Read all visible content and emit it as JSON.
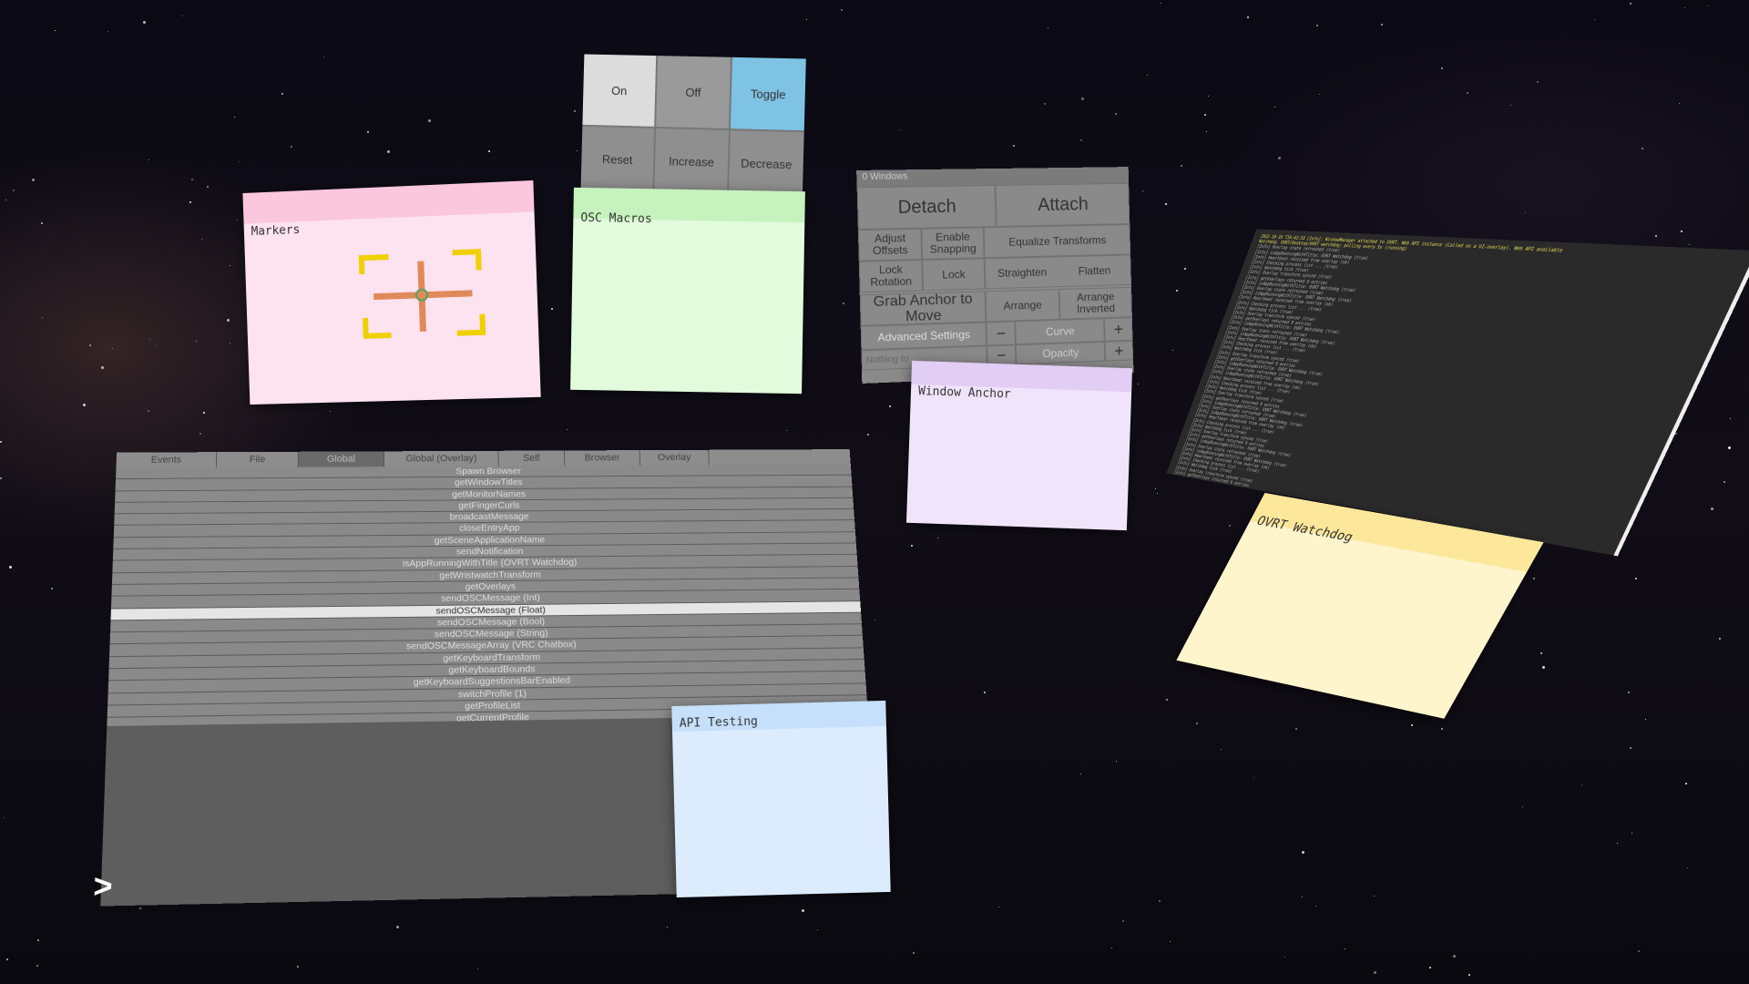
{
  "macro_buttons": {
    "on": "On",
    "off": "Off",
    "toggle": "Toggle",
    "reset": "Reset",
    "increase": "Increase",
    "decrease": "Decrease"
  },
  "notes": {
    "markers": "Markers",
    "osc_macros": "OSC Macros",
    "window_anchor": "Window Anchor",
    "api_testing": "API Testing",
    "ovrt_watchdog": "OVRT Watchdog"
  },
  "window_controls": {
    "title": "0 Windows",
    "detach": "Detach",
    "attach": "Attach",
    "adjust_offsets": "Adjust Offsets",
    "enable_snapping": "Enable Snapping",
    "equalize_transforms": "Equalize Transforms",
    "lock_rotation": "Lock Rotation",
    "lock": "Lock",
    "straighten": "Straighten",
    "flatten": "Flatten",
    "arrange": "Arrange",
    "arrange_inverted": "Arrange Inverted",
    "grab_anchor": "Grab Anchor to Move",
    "curve_minus": "−",
    "curve": "Curve",
    "curve_plus": "+",
    "opacity_minus": "−",
    "opacity": "Opacity",
    "opacity_plus": "+",
    "advanced_settings": "Advanced Settings",
    "status": "Nothing to"
  },
  "api_tabs": [
    "Events",
    "File",
    "Global",
    "Global (Overlay)",
    "Self",
    "Browser",
    "Overlay"
  ],
  "api_functions": [
    "Spawn Browser",
    "getWindowTitles",
    "getMonitorNames",
    "getFingerCurls",
    "broadcastMessage",
    "closeEntryApp",
    "getSceneApplicationName",
    "sendNotification",
    "isAppRunningWithTitle (OVRT Watchdog)",
    "getWristwatchTransform",
    "getOverlays",
    "sendOSCMessage (Int)",
    "sendOSCMessage (Float)",
    "sendOSCMessage (Bool)",
    "sendOSCMessage (String)",
    "sendOSCMessageArray (VRC Chatbox)",
    "getKeyboardTransform",
    "getKeyboardBounds",
    "getKeyboardSuggestionsBarEnabled",
    "switchProfile (1)",
    "getProfileList",
    "getCurrentProfile"
  ],
  "expand_glyph": ">",
  "log": {
    "line1": "2022-10-16 T16:42:33 [Info]: WindowManager attached to OVRT. Web API instance (Called on a UI-overlay). Web API available",
    "line2": "Watchdog: OVRT/Desktop/OVRT watchdog; polling every 5s (running)",
    "rows": [
      "[Info] Overlay state refreshed (true)",
      "[Info] isAppRunningWithTitle: OVRT Watchdog (true)",
      "[Info] Heartbeat received from overlay (ok)",
      "[Info] Checking process list ... (true)",
      "[Info] Watchdog tick (true)",
      "[Info] Overlay transform synced (true)",
      "[Info] getOverlays returned 9 entries",
      "[Info] isAppRunningWithTitle: OVRT Watchdog (true)"
    ]
  },
  "colors": {
    "toggle_active": "#7ec3e4",
    "markers_note": "#fde2ef",
    "osc_note": "#e2fbdc",
    "anchor_note": "#f0e4fa",
    "api_note": "#dcecfd",
    "watchdog_note": "#fff5cc",
    "marker_bracket": "#f0d000",
    "marker_cross": "#e08a5a"
  }
}
